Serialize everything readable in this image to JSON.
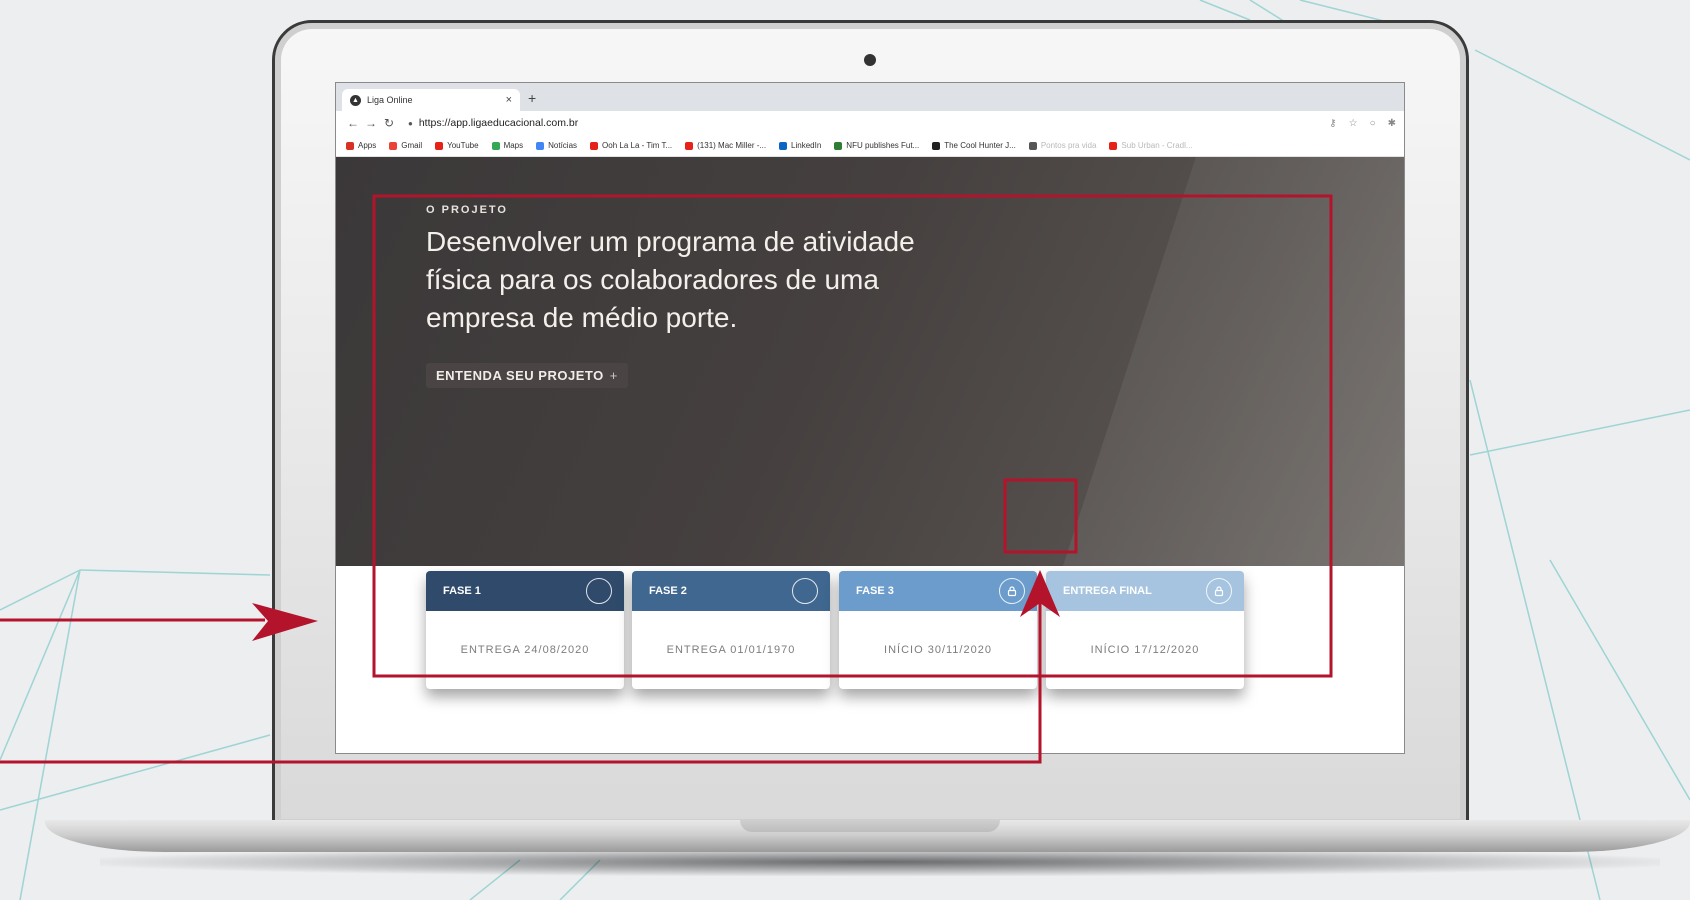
{
  "browser": {
    "tab_title": "Liga Online",
    "tab_close": "×",
    "new_tab": "+",
    "url": "https://app.ligaeducacional.com.br",
    "bookmarks": [
      {
        "label": "Apps",
        "color": "#d93025"
      },
      {
        "label": "Gmail",
        "color": "#ea4335"
      },
      {
        "label": "YouTube",
        "color": "#e62117"
      },
      {
        "label": "Maps",
        "color": "#34a853"
      },
      {
        "label": "Notícias",
        "color": "#4285f4"
      },
      {
        "label": "Ooh La La - Tim T...",
        "color": "#e62117"
      },
      {
        "label": "(131) Mac Miller -...",
        "color": "#e62117"
      },
      {
        "label": "LinkedIn",
        "color": "#0a66c2"
      },
      {
        "label": "NFU publishes Fut...",
        "color": "#2e7d32"
      },
      {
        "label": "The Cool Hunter J...",
        "color": "#222222"
      },
      {
        "label": "Pontos pra vida",
        "color": "#555555"
      },
      {
        "label": "Sub Urban - Cradl...",
        "color": "#e62117"
      }
    ]
  },
  "hero": {
    "eyebrow": "O PROJETO",
    "headline": "Desenvolver um programa de atividade física para os colaboradores de uma empresa de médio porte.",
    "cta_label": "ENTENDA SEU PROJETO",
    "cta_plus": "+"
  },
  "phases": [
    {
      "title": "FASE 1",
      "date": "ENTREGA 24/08/2020",
      "color": "#2f4a6b",
      "icon": "circle-icon"
    },
    {
      "title": "FASE 2",
      "date": "ENTREGA 01/01/1970",
      "color": "#3f678f",
      "icon": "circle-icon"
    },
    {
      "title": "FASE 3",
      "date": "INÍCIO 30/11/2020",
      "color": "#6b9ccb",
      "icon": "lock-icon"
    },
    {
      "title": "ENTREGA FINAL",
      "date": "INÍCIO 17/12/2020",
      "color": "#a6c4df",
      "icon": "lock-icon"
    }
  ],
  "annotation_color": "#b3132b"
}
